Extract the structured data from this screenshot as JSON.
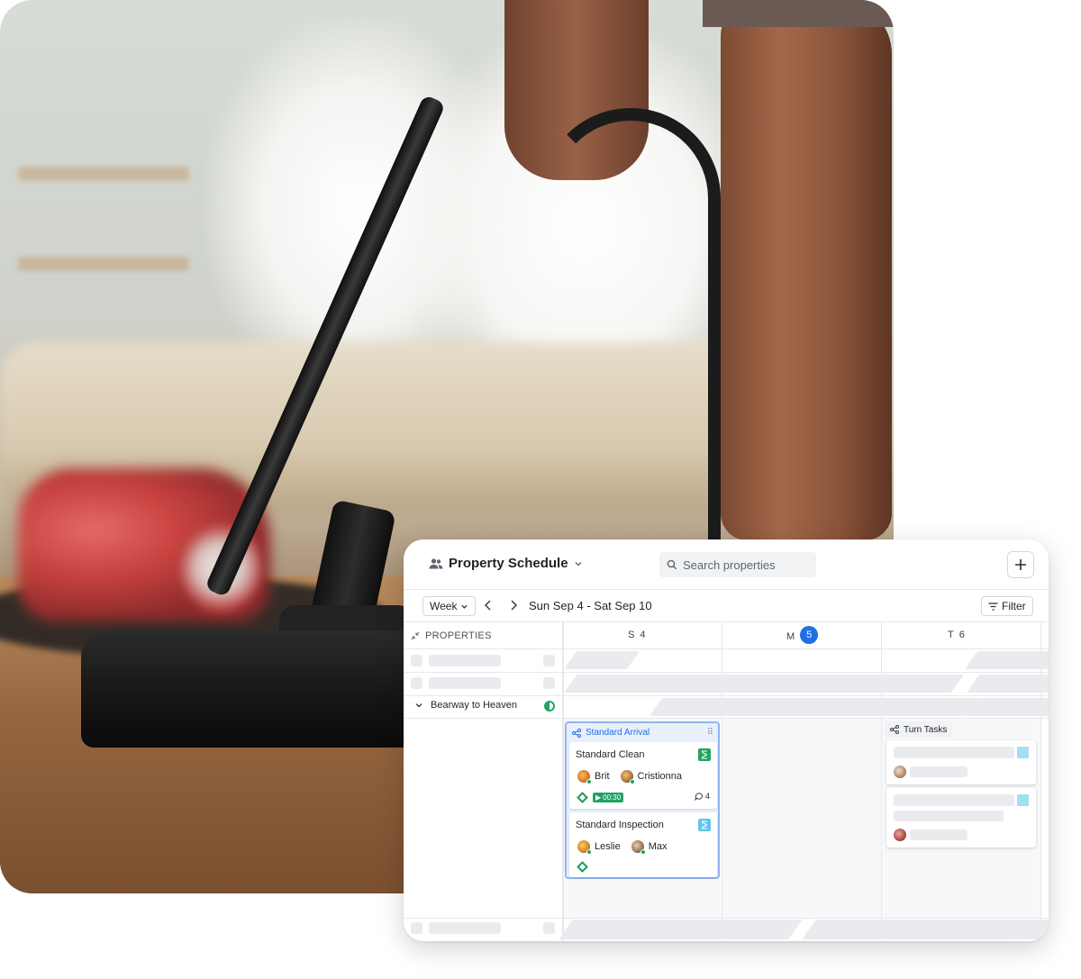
{
  "app": {
    "title": "Property Schedule",
    "search_placeholder": "Search properties",
    "add_icon": "plus-icon",
    "view_label": "Week",
    "date_range": "Sun Sep 4 - Sat Sep 10",
    "filter_label": "Filter",
    "properties_header": "PROPERTIES"
  },
  "days": [
    {
      "letter": "S",
      "date": "4",
      "today": false
    },
    {
      "letter": "M",
      "date": "5",
      "today": true
    },
    {
      "letter": "T",
      "date": "6",
      "today": false
    }
  ],
  "property": {
    "name": "Bearway to Heaven"
  },
  "group": {
    "title": "Standard Arrival",
    "tasks": [
      {
        "title": "Standard Clean",
        "assignees": [
          "Brit",
          "Cristionna"
        ],
        "timer": "00:30",
        "comments": "4"
      },
      {
        "title": "Standard Inspection",
        "assignees": [
          "Leslie",
          "Max"
        ]
      }
    ]
  },
  "turn_tasks": {
    "title": "Turn Tasks"
  },
  "colors": {
    "accent": "#1f6fe5",
    "success": "#20a464",
    "group_bg": "#e9f0fc",
    "group_border": "#8fb6f2",
    "placeholder": "#e9ebee",
    "light_blue": "#a6dcf5"
  }
}
